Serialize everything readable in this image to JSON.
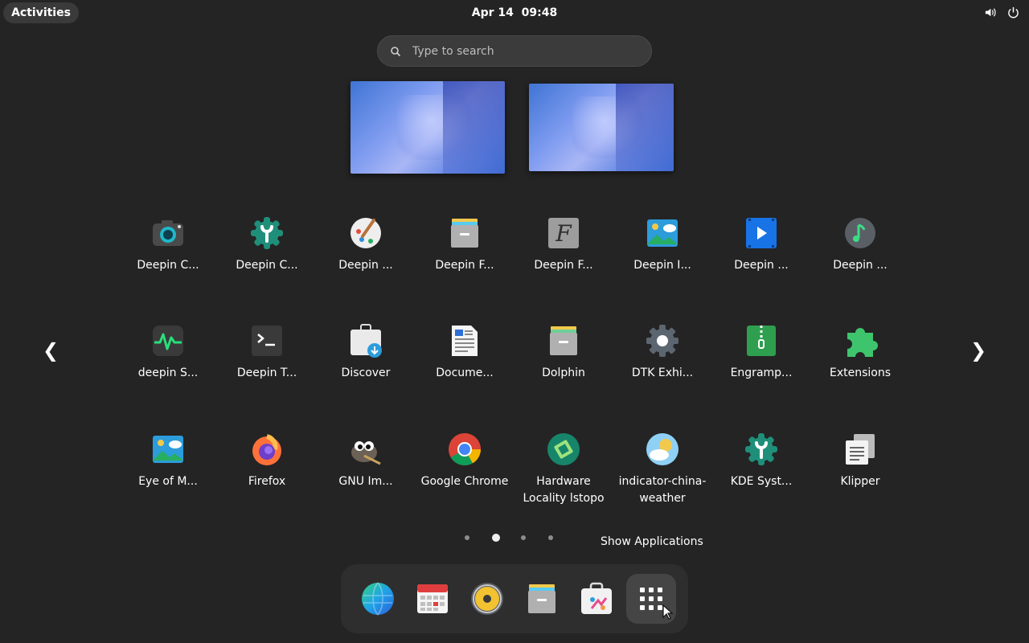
{
  "topbar": {
    "activities_label": "Activities",
    "clock": "Apr 14  09:48",
    "tray": [
      {
        "icon": "volume-icon"
      },
      {
        "icon": "power-icon"
      }
    ]
  },
  "search": {
    "placeholder": "Type to search"
  },
  "workspaces": [
    {
      "name": "workspace-1"
    },
    {
      "name": "workspace-2"
    }
  ],
  "apps": [
    {
      "label": "Deepin C...",
      "icon": "camera-icon"
    },
    {
      "label": "Deepin C...",
      "icon": "control-center-icon"
    },
    {
      "label": "Deepin ...",
      "icon": "draw-palette-icon"
    },
    {
      "label": "Deepin F...",
      "icon": "file-manager-icon"
    },
    {
      "label": "Deepin F...",
      "icon": "font-manager-icon"
    },
    {
      "label": "Deepin I...",
      "icon": "image-viewer-icon"
    },
    {
      "label": "Deepin ...",
      "icon": "movie-icon"
    },
    {
      "label": "Deepin ...",
      "icon": "music-icon"
    },
    {
      "label": "deepin S...",
      "icon": "system-monitor-icon"
    },
    {
      "label": "Deepin T...",
      "icon": "terminal-icon"
    },
    {
      "label": "Discover",
      "icon": "discover-icon"
    },
    {
      "label": "Docume...",
      "icon": "document-viewer-icon"
    },
    {
      "label": "Dolphin",
      "icon": "dolphin-icon"
    },
    {
      "label": "DTK Exhi...",
      "icon": "dtk-gear-icon"
    },
    {
      "label": "Engramp...",
      "icon": "archive-zip-icon"
    },
    {
      "label": "Extensions",
      "icon": "puzzle-icon"
    },
    {
      "label": "Eye of M...",
      "icon": "eye-of-mate-icon"
    },
    {
      "label": "Firefox",
      "icon": "firefox-icon"
    },
    {
      "label": "GNU Im...",
      "icon": "gimp-icon"
    },
    {
      "label": "Google Chrome",
      "icon": "chrome-icon"
    },
    {
      "label": "Hardware Locality lstopo",
      "icon": "hardware-locality-icon"
    },
    {
      "label": "indicator-china-weather",
      "icon": "weather-icon"
    },
    {
      "label": "KDE Syst...",
      "icon": "kde-system-settings-icon"
    },
    {
      "label": "Klipper",
      "icon": "klipper-icon"
    }
  ],
  "nav": {
    "prev": "❮",
    "next": "❯"
  },
  "pages": {
    "count": 4,
    "current": 2
  },
  "show_apps_label": "Show Applications",
  "dock": [
    {
      "icon": "browser-globe-icon"
    },
    {
      "icon": "calendar-icon"
    },
    {
      "icon": "music-player-icon"
    },
    {
      "icon": "file-manager-icon"
    },
    {
      "icon": "app-store-icon"
    },
    {
      "icon": "show-apps-grid-icon",
      "selected": true
    }
  ]
}
